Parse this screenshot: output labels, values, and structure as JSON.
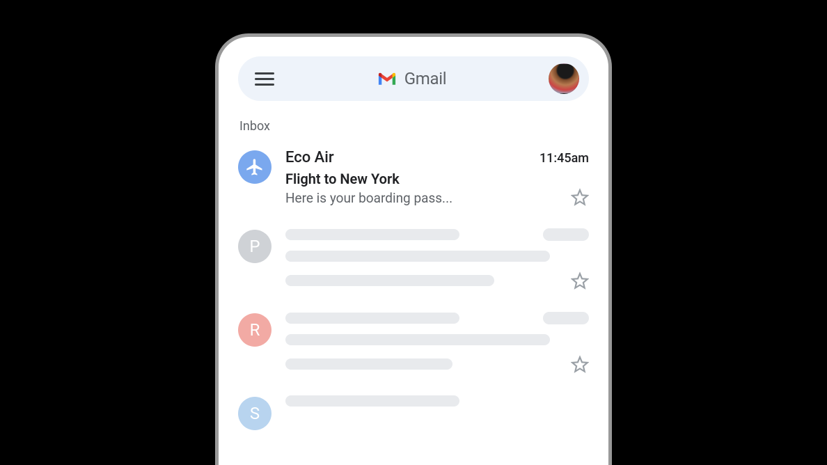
{
  "header": {
    "app_name": "Gmail"
  },
  "inbox": {
    "label": "Inbox",
    "emails": [
      {
        "sender": "Eco Air",
        "subject": "Flight to New York",
        "snippet": "Here is your boarding pass...",
        "time": "11:45am",
        "avatar_color": "#7aa8ee",
        "icon": "airplane"
      }
    ],
    "placeholders": [
      {
        "initial": "P",
        "color": "#cfd2d6"
      },
      {
        "initial": "R",
        "color": "#f2aaa4"
      },
      {
        "initial": "S",
        "color": "#b8d4ef"
      }
    ]
  }
}
